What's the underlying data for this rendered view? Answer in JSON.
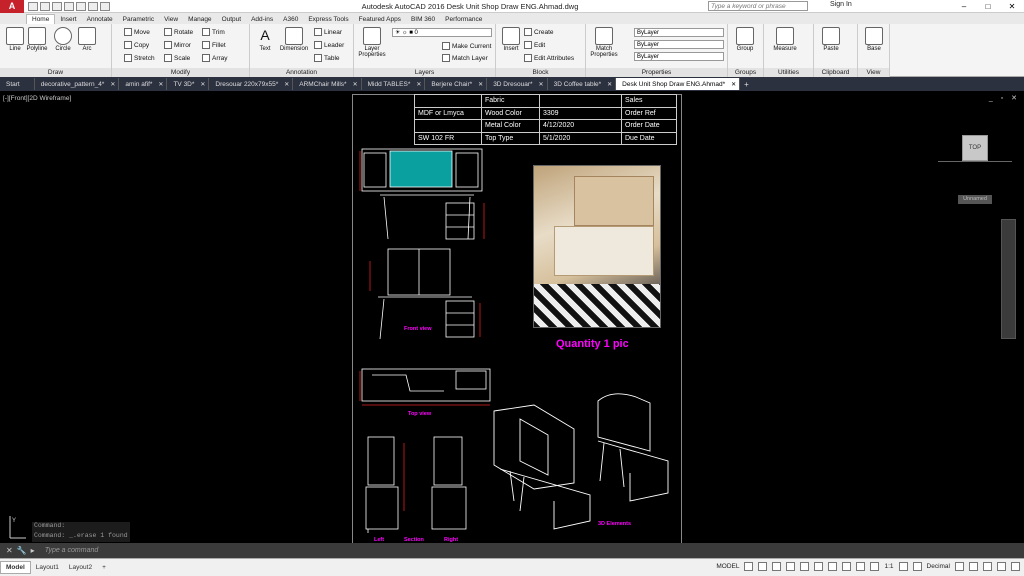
{
  "window": {
    "app_logo": "A",
    "title": "Autodesk AutoCAD 2016   Desk Unit Shop Draw ENG.Ahmad.dwg",
    "search_placeholder": "Type a keyword or phrase",
    "signin": "Sign In"
  },
  "ribbon_tabs": [
    "Home",
    "Insert",
    "Annotate",
    "Parametric",
    "View",
    "Manage",
    "Output",
    "Add-ins",
    "A360",
    "Express Tools",
    "Featured Apps",
    "BIM 360",
    "Performance"
  ],
  "ribbon": {
    "draw": {
      "title": "Draw",
      "line": "Line",
      "polyline": "Polyline",
      "circle": "Circle",
      "arc": "Arc"
    },
    "modify": {
      "title": "Modify",
      "move": "Move",
      "rotate": "Rotate",
      "trim": "Trim",
      "copy": "Copy",
      "mirror": "Mirror",
      "fillet": "Fillet",
      "stretch": "Stretch",
      "scale": "Scale",
      "array": "Array"
    },
    "annotation": {
      "title": "Annotation",
      "text": "Text",
      "dimension": "Dimension",
      "linear": "Linear",
      "leader": "Leader",
      "table": "Table"
    },
    "layers": {
      "title": "Layers",
      "layer_properties": "Layer Properties",
      "layer_value": "0",
      "make_current": "Make Current",
      "match_layer": "Match Layer"
    },
    "block": {
      "title": "Block",
      "insert": "Insert",
      "create": "Create",
      "edit": "Edit",
      "edit_attributes": "Edit Attributes"
    },
    "properties": {
      "title": "Properties",
      "match_properties": "Match Properties",
      "bylayer1": "ByLayer",
      "bylayer2": "ByLayer",
      "bylayer3": "ByLayer"
    },
    "groups": {
      "title": "Groups",
      "group": "Group"
    },
    "utilities": {
      "title": "Utilities",
      "measure": "Measure"
    },
    "clipboard": {
      "title": "Clipboard",
      "paste": "Paste"
    },
    "view": {
      "title": "View",
      "base": "Base"
    }
  },
  "file_tabs": [
    "Start",
    "decorative_pattern_4*",
    "amin afif*",
    "TV 3D*",
    "Dresouar 220x79x55*",
    "ARMChair Mills*",
    "Midd TABLES*",
    "Berjere Chair*",
    "3D Dresouar*",
    "3D Coffee table*",
    "Desk Unit Shop Draw ENG.Ahmad*"
  ],
  "viewport": {
    "label": "[-][Front][2D Wireframe]",
    "viewcube": "TOP",
    "named_view": "Unnamed"
  },
  "info_table": [
    [
      "",
      "Fabric",
      "",
      "Sales"
    ],
    [
      "MDF or Lmyca",
      "Wood Color",
      "3309",
      "Order Ref"
    ],
    [
      "",
      "Metal Color",
      "4/12/2020",
      "Order Date"
    ],
    [
      "SW 102 FR",
      "Top Type",
      "5/1/2020",
      "Due Date"
    ]
  ],
  "drawing": {
    "quantity": "Quantity 1 pic",
    "front_view": "Front view",
    "top_view": "Top view",
    "view_3d": "3D Elements",
    "left": "Left",
    "section": "Section",
    "right": "Right"
  },
  "command": {
    "history1": "Command:",
    "history2": "Command: _.erase 1 found",
    "placeholder": "Type a command"
  },
  "layout_tabs": [
    "Model",
    "Layout1",
    "Layout2"
  ],
  "status": {
    "model": "MODEL",
    "scale": "1:1",
    "units": "Decimal"
  }
}
